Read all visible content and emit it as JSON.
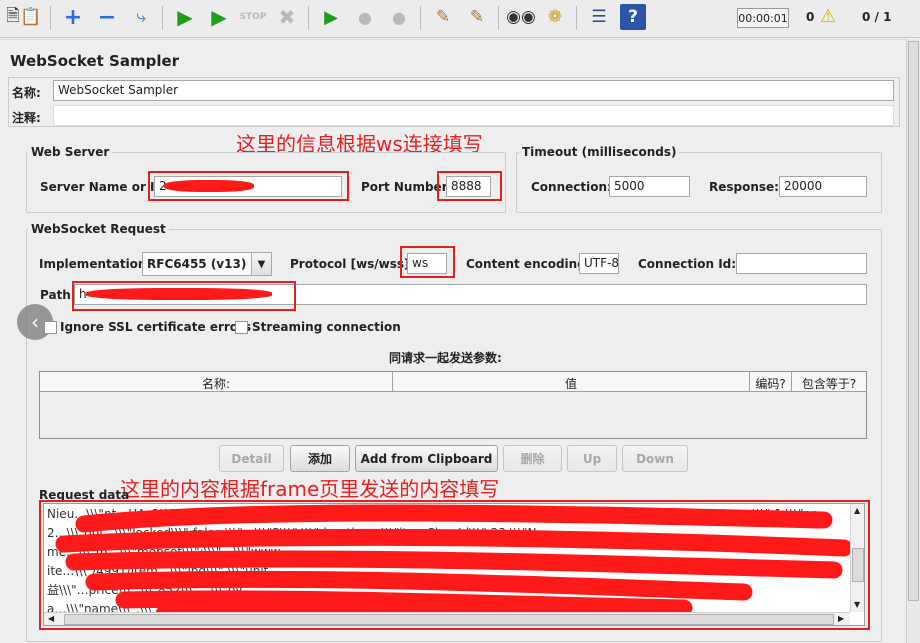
{
  "toolbar": {
    "icons": [
      "template-icon",
      "clipboard-icon",
      "add-icon",
      "remove-icon",
      "toggle-icon",
      "start-icon",
      "start-no-pause-icon",
      "stop-icon",
      "shutdown-icon",
      "remote-start-icon",
      "remote-stop-icon",
      "remote-shutdown-icon",
      "clear-icon",
      "clear-all-icon",
      "search-icon",
      "broom-icon",
      "function-helper-icon",
      "help-icon"
    ],
    "timer": "00:00:01",
    "warning_count": "0",
    "threads": "0 / 1"
  },
  "panel": {
    "title": "WebSocket Sampler"
  },
  "name_row": {
    "label": "名称:",
    "value": "WebSocket Sampler"
  },
  "comment_row": {
    "label": "注释:",
    "value": ""
  },
  "annotations": {
    "ws_note": "这里的信息根据ws连接填写",
    "frame_note": "这里的内容根据frame页里发送的内容填写",
    "color": "#e52020"
  },
  "web_server": {
    "legend": "Web Server",
    "server_label": "Server Name or IP:",
    "server_value": "2",
    "port_label": "Port Number:",
    "port_value": "8888"
  },
  "timeout": {
    "legend": "Timeout (milliseconds)",
    "connection_label": "Connection:",
    "connection_value": "5000",
    "response_label": "Response:",
    "response_value": "20000"
  },
  "ws_request": {
    "legend": "WebSocket Request",
    "impl_label": "Implementation:",
    "impl_value": "RFC6455 (v13)",
    "protocol_label": "Protocol [ws/wss]:",
    "protocol_value": "ws",
    "encoding_label": "Content encoding:",
    "encoding_value": "UTF-8",
    "connid_label": "Connection Id:",
    "connid_value": "",
    "path_label": "Path:",
    "path_value": "h",
    "ssl_label": "Ignore SSL certificate errors",
    "streaming_label": "Streaming connection"
  },
  "params": {
    "title": "同请求一起发送参数:",
    "columns": [
      "名称:",
      "值",
      "编码?",
      "包含等于?"
    ]
  },
  "buttons": {
    "detail": "Detail",
    "add": "添加",
    "add_clipboard": "Add from Clipboard",
    "delete": "删除",
    "up": "Up",
    "down": "Down"
  },
  "request_data": {
    "label": "Request data",
    "lines": [
      "Nieu…\\\\\\\"pt…HArQWTq1FVfl…n9w/0\\\\\\\",\\\\\\\"category\\\\\\\":\\\\\\\"10\\\\\\\",\\\\\\\"classId\\\\\\\":\\\\\\\"23\\\\\\\",\\\\\\\"itemId\\\\\\\":\\\\\\\"852\\\\\\\",\\\\\\\"num\\\\\\\":1,\\\\\\\"op",
      "2…\\\\\\\"gol…\\\\\\\"locked\\\\\\\":false,\\\\\\\"…\\\\\\\"2\\\\\\\",\\\\\\\"duration…\\\\\\\"itemClassId\\\\\\\":23,\\\\\\\"N",
      "me…\\\\\\\"m…\\\\\\\"mobset\\\\\\\":\\\\\\\"…\\\\\\\"www",
      "ite…\\\\\\\"/4991/item…\\\\\\\"jpg\\\\\\\",\\\\\\\"unit",
      "益\\\\\\\"…price\\\\\\\":\\\\\\\"852\\\\\\\"…\\\\\\\"oy",
      "a…\\\\\\\"name\\\\\\\":\\\\\\\"草酒\\\\\\\",\\\\\\\"actionType\\\\\\\":\\\\\\\"1\\\\\\\",\\\\\\\"className\\\\\\\":\\\\\\\"保菜类\\\\\\\"}]"
    ]
  }
}
